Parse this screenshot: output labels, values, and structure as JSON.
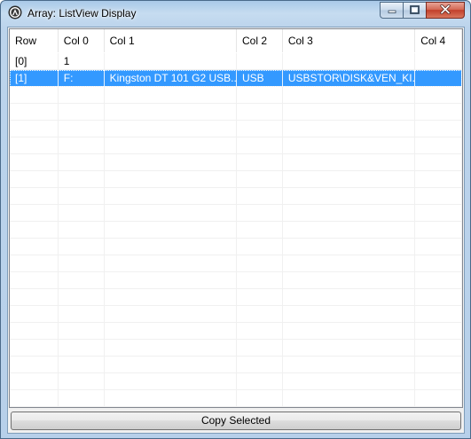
{
  "window": {
    "title": "Array: ListView Display"
  },
  "colors": {
    "selection": "#3399ff",
    "close_button": "#c2402b"
  },
  "listview": {
    "columns": [
      "Row",
      "Col 0",
      "Col 1",
      "Col 2",
      "Col 3",
      "Col 4"
    ],
    "rows": [
      [
        "[0]",
        "1",
        "",
        "",
        "",
        ""
      ],
      [
        "[1]",
        "F:",
        "Kingston DT 101 G2 USB...",
        "USB",
        "USBSTOR\\DISK&VEN_KI...",
        ""
      ]
    ],
    "selected_row": 1
  },
  "button": {
    "copy_label": "Copy Selected"
  },
  "icons": {
    "app": "autoit-icon",
    "minimize": "minimize-icon",
    "maximize": "maximize-icon",
    "close": "close-icon"
  }
}
